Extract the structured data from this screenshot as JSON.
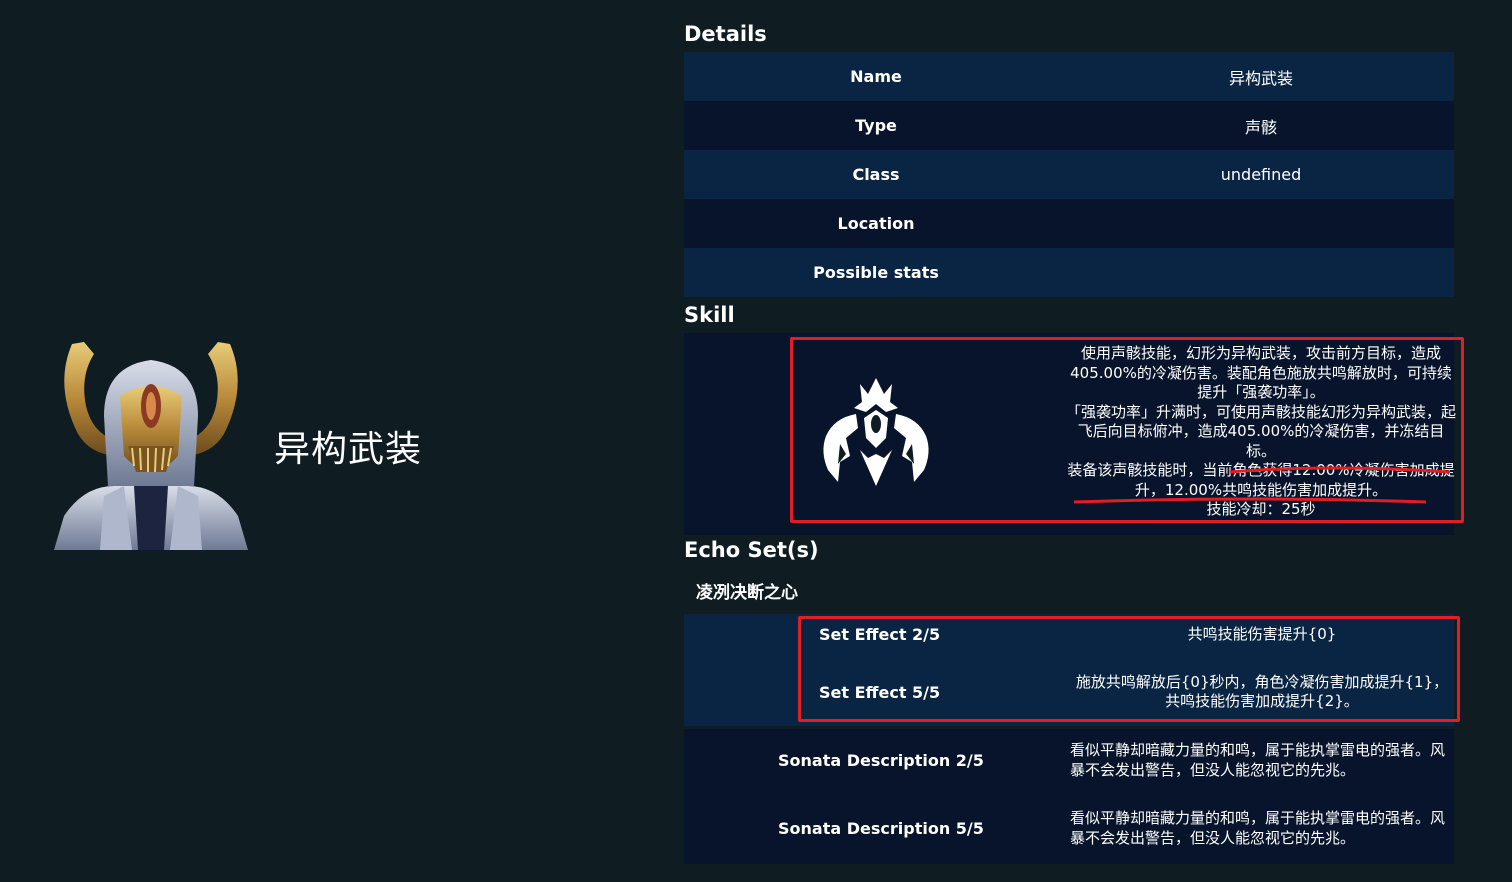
{
  "hero": {
    "title": "异构武装",
    "image_icon": "echo-portrait-icon"
  },
  "details": {
    "heading": "Details",
    "rows": [
      {
        "key": "Name",
        "value": "异构武装"
      },
      {
        "key": "Type",
        "value": "声骸"
      },
      {
        "key": "Class",
        "value": "undefined"
      },
      {
        "key": "Location",
        "value": ""
      },
      {
        "key": "Possible stats",
        "value": ""
      }
    ]
  },
  "skill": {
    "heading": "Skill",
    "icon": "skill-emblem-icon",
    "lines": [
      "使用声骸技能，幻形为异构武装，攻击前方目标，造成405.00%的冷凝伤害。装配角色施放共鸣解放时，可持续提升「强袭功率」。",
      "「强袭功率」升满时，可使用声骸技能幻形为异构武装，起飞后向目标俯冲，造成405.00%的冷凝伤害，并冻结目标。",
      "装备该声骸技能时，当前角色获得12.00%冷凝伤害加成提升，12.00%共鸣技能伤害加成提升。",
      "技能冷却：25秒"
    ]
  },
  "echo_set": {
    "heading": "Echo Set(s)",
    "set_name": "凌冽决断之心",
    "effects": [
      {
        "key": "Set Effect 2/5",
        "value": "共鸣技能伤害提升{0}"
      },
      {
        "key": "Set Effect 5/5",
        "value": "施放共鸣解放后{0}秒内，角色冷凝伤害加成提升{1}，共鸣技能伤害加成提升{2}。"
      }
    ],
    "sonata": [
      {
        "key": "Sonata Description 2/5",
        "value": "看似平静却暗藏力量的和鸣，属于能执掌雷电的强者。风暴不会发出警告，但没人能忽视它的先兆。"
      },
      {
        "key": "Sonata Description 5/5",
        "value": "看似平静却暗藏力量的和鸣，属于能执掌雷电的强者。风暴不会发出警告，但没人能忽视它的先兆。"
      }
    ]
  },
  "colors": {
    "background": "#0f1c22",
    "row_light": "#0a2443",
    "row_dark": "#08142b",
    "highlight": "#e01e24",
    "gold": "#c9a24a"
  }
}
